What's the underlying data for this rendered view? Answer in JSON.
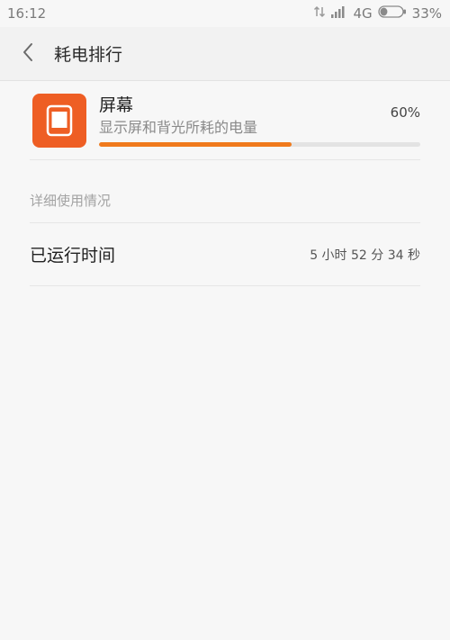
{
  "status_bar": {
    "time": "16:12",
    "network": "4G",
    "battery_percent": "33%",
    "battery_level": 0.33
  },
  "header": {
    "title": "耗电排行"
  },
  "app_item": {
    "name": "屏幕",
    "description": "显示屏和背光所耗的电量",
    "percent": "60%",
    "usage_fraction": 0.6,
    "icon": "screen-icon",
    "icon_color": "#ee5e24",
    "bar_color": "#f07a1c"
  },
  "section": {
    "label": "详细使用情况"
  },
  "details": {
    "runtime_label": "已运行时间",
    "runtime_value": "5 小时 52 分 34 秒"
  }
}
